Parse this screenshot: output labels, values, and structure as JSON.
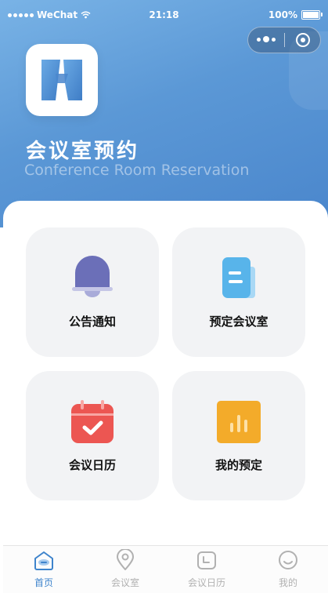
{
  "status_bar": {
    "carrier": "WeChat",
    "time": "21:18",
    "battery": "100%"
  },
  "header": {
    "title": "会议室预约",
    "subtitle": "Conference Room Reservation"
  },
  "menu": [
    {
      "label": "公告通知",
      "icon": "bell-icon",
      "color": "#6b6fb8"
    },
    {
      "label": "预定会议室",
      "icon": "document-icon",
      "color": "#58b4ea"
    },
    {
      "label": "会议日历",
      "icon": "calendar-icon",
      "color": "#ec5652"
    },
    {
      "label": "我的预定",
      "icon": "bar-chart-icon",
      "color": "#f3ab2a"
    }
  ],
  "tabs": [
    {
      "label": "首页",
      "icon": "home-icon",
      "active": true
    },
    {
      "label": "会议室",
      "icon": "location-pin-icon",
      "active": false
    },
    {
      "label": "会议日历",
      "icon": "calendar-icon",
      "active": false
    },
    {
      "label": "我的",
      "icon": "smiley-icon",
      "active": false
    }
  ],
  "colors": {
    "header_gradient_start": "#79b3e6",
    "header_gradient_end": "#4a86cc",
    "card_bg": "#f2f3f5",
    "tab_active": "#3e84cc",
    "tab_inactive": "#b1b1b1"
  }
}
